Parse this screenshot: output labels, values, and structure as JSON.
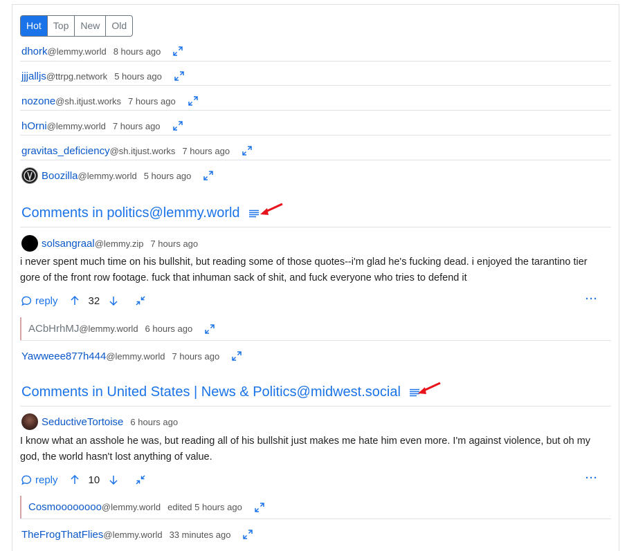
{
  "sort_tabs": [
    "Hot",
    "Top",
    "New",
    "Old"
  ],
  "active_sort": "Hot",
  "top_users": [
    {
      "name": "dhork",
      "instance": "@lemmy.world",
      "time": "8 hours ago"
    },
    {
      "name": "jjjalljs",
      "instance": "@ttrpg.network",
      "time": "5 hours ago"
    },
    {
      "name": "nozone",
      "instance": "@sh.itjust.works",
      "time": "7 hours ago"
    },
    {
      "name": "hOrni",
      "instance": "@lemmy.world",
      "time": "7 hours ago"
    },
    {
      "name": "gravitas_deficiency",
      "instance": "@sh.itjust.works",
      "time": "7 hours ago"
    },
    {
      "name": "Boozilla",
      "instance": "@lemmy.world",
      "time": "5 hours ago"
    }
  ],
  "sections": [
    {
      "title": "Comments in politics@lemmy.world",
      "comment": {
        "name": "solsangraal",
        "instance": "@lemmy.zip",
        "time": "7 hours ago",
        "text": "i never spent much time on his bullshit, but reading some of those quotes--i'm glad he's fucking dead. i enjoyed the tarantino tier gore of the front row footage. fuck that inhuman sack of shit, and fuck everyone who tries to defend it",
        "reply_label": "reply",
        "score": "32"
      },
      "child": {
        "name": "ACbHrhMJ",
        "instance": "@lemmy.world",
        "time": "6 hours ago"
      },
      "next": {
        "name": "Yawweee877h444",
        "instance": "@lemmy.world",
        "time": "7 hours ago"
      }
    },
    {
      "title": "Comments in United States | News & Politics@midwest.social",
      "comment": {
        "name": "SeductiveTortoise",
        "instance": "",
        "time": "6 hours ago",
        "text": "I know what an asshole he was, but reading all of his bullshit just makes me hate him even more. I'm against violence, but oh my god, the world hasn't lost anything of value.",
        "reply_label": "reply",
        "score": "10"
      },
      "child": {
        "name": "Cosmoooooooo",
        "instance": "@lemmy.world",
        "time": "edited 5 hours ago"
      },
      "next": {
        "name": "TheFrogThatFlies",
        "instance": "@lemmy.world",
        "time": "33 minutes ago"
      }
    }
  ],
  "more_label": "···",
  "colors": {
    "accent": "#1a73e8",
    "link": "#0a58ca",
    "annotation_arrow": "#e8141b"
  }
}
